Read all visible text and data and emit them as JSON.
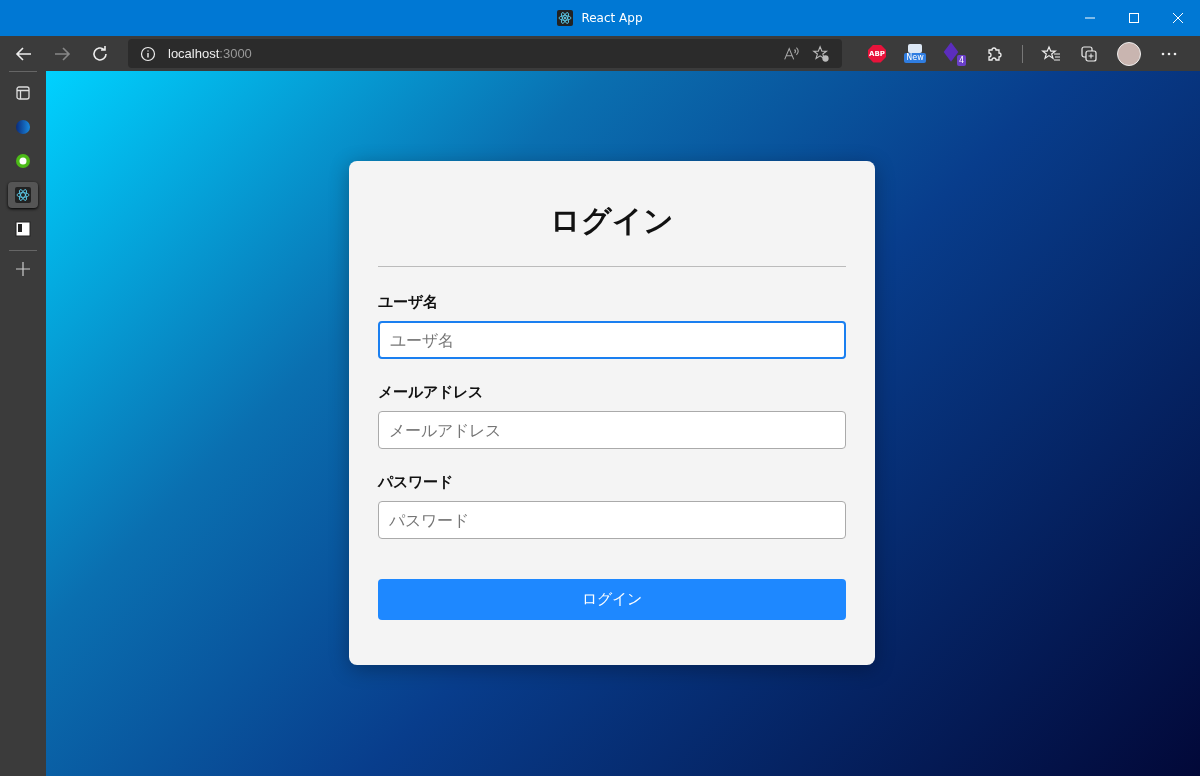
{
  "window": {
    "title": "React App"
  },
  "toolbar": {
    "address_host": "localhost",
    "address_port": ":3000",
    "extensions": [
      {
        "kind": "abp",
        "label": "ABP"
      },
      {
        "kind": "new",
        "label": "New"
      },
      {
        "kind": "count",
        "label": "4"
      }
    ]
  },
  "sidebar": {
    "tabs": [
      {
        "kind": "panel",
        "selected": false
      },
      {
        "kind": "blue",
        "selected": false
      },
      {
        "kind": "green",
        "selected": false
      },
      {
        "kind": "react",
        "selected": true
      },
      {
        "kind": "board",
        "selected": false
      }
    ]
  },
  "form": {
    "title": "ログイン",
    "fields": [
      {
        "label": "ユーザ名",
        "placeholder": "ユーザ名",
        "focused": true
      },
      {
        "label": "メールアドレス",
        "placeholder": "メールアドレス",
        "focused": false
      },
      {
        "label": "パスワード",
        "placeholder": "パスワード",
        "focused": false
      }
    ],
    "button": "ログイン"
  }
}
